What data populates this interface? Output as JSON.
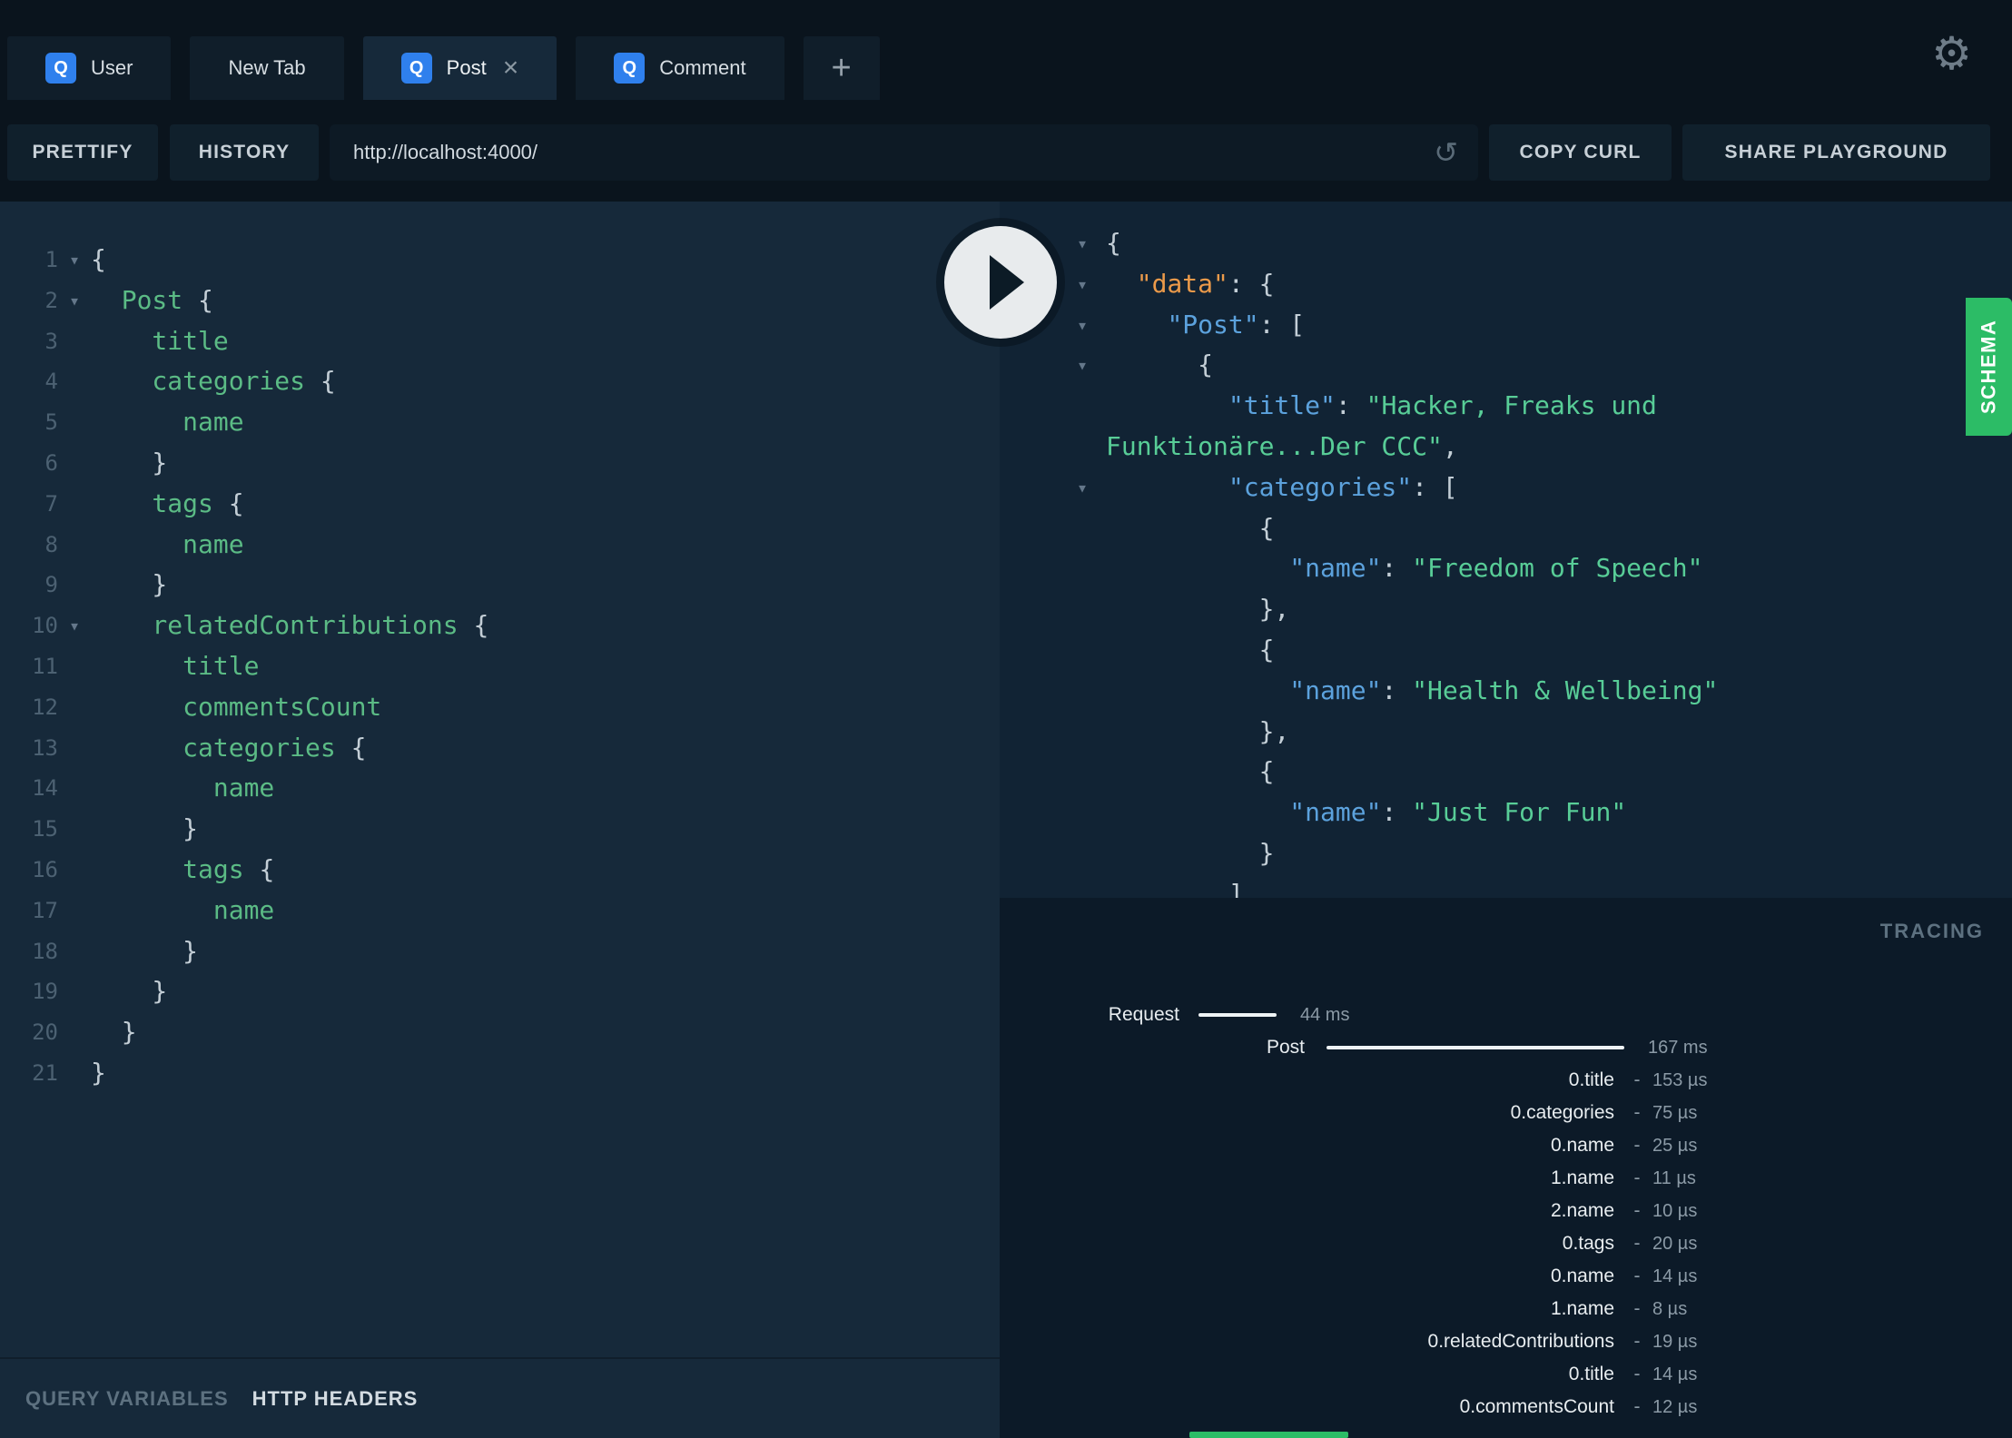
{
  "colors": {
    "bg_top": "#0a141d",
    "tab_inactive": "#101e2a",
    "editor_bg": "#16293a",
    "response_bg": "#112334",
    "tracing_bg": "#0c1a28",
    "button_bg": "#10202c",
    "url_bg": "#0d1a25",
    "accent_blue": "#2f80ed",
    "schema_green": "#2cbc66",
    "code_green": "#5bbb85",
    "str_green": "#58cd97",
    "key_blue": "#5ca2dd",
    "key_orange": "#eb9a4a",
    "punct": "#c3ced6",
    "line_number": "#4c6172",
    "text_primary": "#d7dee3",
    "text_muted": "#5d7180",
    "time_muted": "#8b9aa6"
  },
  "icons": {
    "gear": "⚙",
    "reload": "↺",
    "close": "×",
    "plus": "+",
    "fold": "▾"
  },
  "tabs": [
    {
      "label": "User",
      "badge": "Q",
      "active": false,
      "closable": false
    },
    {
      "label": "New Tab",
      "badge": "",
      "active": false,
      "closable": false
    },
    {
      "label": "Post",
      "badge": "Q",
      "active": true,
      "closable": true
    },
    {
      "label": "Comment",
      "badge": "Q",
      "active": false,
      "closable": false
    }
  ],
  "toolbar": {
    "prettify": "PRETTIFY",
    "history": "HISTORY",
    "url": "http://localhost:4000/",
    "copy_curl": "COPY CURL",
    "share_playground": "SHARE PLAYGROUND"
  },
  "query_editor": {
    "lines": [
      {
        "n": 1,
        "fold": true,
        "segs": [
          [
            "p",
            "{"
          ]
        ]
      },
      {
        "n": 2,
        "fold": true,
        "segs": [
          [
            "g",
            "  Post "
          ],
          [
            "p",
            "{"
          ]
        ]
      },
      {
        "n": 3,
        "fold": false,
        "segs": [
          [
            "g",
            "    title"
          ]
        ]
      },
      {
        "n": 4,
        "fold": false,
        "segs": [
          [
            "g",
            "    categories "
          ],
          [
            "p",
            "{"
          ]
        ]
      },
      {
        "n": 5,
        "fold": false,
        "segs": [
          [
            "g",
            "      name"
          ]
        ]
      },
      {
        "n": 6,
        "fold": false,
        "segs": [
          [
            "p",
            "    }"
          ]
        ]
      },
      {
        "n": 7,
        "fold": false,
        "segs": [
          [
            "g",
            "    tags "
          ],
          [
            "p",
            "{"
          ]
        ]
      },
      {
        "n": 8,
        "fold": false,
        "segs": [
          [
            "g",
            "      name"
          ]
        ]
      },
      {
        "n": 9,
        "fold": false,
        "segs": [
          [
            "p",
            "    }"
          ]
        ]
      },
      {
        "n": 10,
        "fold": true,
        "segs": [
          [
            "g",
            "    relatedContributions "
          ],
          [
            "p",
            "{"
          ]
        ]
      },
      {
        "n": 11,
        "fold": false,
        "segs": [
          [
            "g",
            "      title"
          ]
        ]
      },
      {
        "n": 12,
        "fold": false,
        "segs": [
          [
            "g",
            "      commentsCount"
          ]
        ]
      },
      {
        "n": 13,
        "fold": false,
        "segs": [
          [
            "g",
            "      categories "
          ],
          [
            "p",
            "{"
          ]
        ]
      },
      {
        "n": 14,
        "fold": false,
        "segs": [
          [
            "g",
            "        name"
          ]
        ]
      },
      {
        "n": 15,
        "fold": false,
        "segs": [
          [
            "p",
            "      }"
          ]
        ]
      },
      {
        "n": 16,
        "fold": false,
        "segs": [
          [
            "g",
            "      tags "
          ],
          [
            "p",
            "{"
          ]
        ]
      },
      {
        "n": 17,
        "fold": false,
        "segs": [
          [
            "g",
            "        name"
          ]
        ]
      },
      {
        "n": 18,
        "fold": false,
        "segs": [
          [
            "p",
            "      }"
          ]
        ]
      },
      {
        "n": 19,
        "fold": false,
        "segs": [
          [
            "p",
            "    }"
          ]
        ]
      },
      {
        "n": 20,
        "fold": false,
        "segs": [
          [
            "p",
            "  }"
          ]
        ]
      },
      {
        "n": 21,
        "fold": false,
        "segs": [
          [
            "p",
            "}"
          ]
        ]
      }
    ]
  },
  "response_viewer": {
    "lines": [
      {
        "fold": true,
        "segs": [
          [
            "p",
            "{"
          ]
        ]
      },
      {
        "fold": true,
        "segs": [
          [
            "p",
            "  "
          ],
          [
            "o",
            "\"data\""
          ],
          [
            "p",
            ": {"
          ]
        ]
      },
      {
        "fold": true,
        "segs": [
          [
            "p",
            "    "
          ],
          [
            "b",
            "\"Post\""
          ],
          [
            "p",
            ": ["
          ]
        ]
      },
      {
        "fold": true,
        "segs": [
          [
            "p",
            "      {"
          ]
        ]
      },
      {
        "fold": false,
        "segs": [
          [
            "p",
            "        "
          ],
          [
            "b",
            "\"title\""
          ],
          [
            "p",
            ": "
          ],
          [
            "s",
            "\"Hacker, Freaks und"
          ]
        ]
      },
      {
        "fold": false,
        "segs": [
          [
            "s",
            "Funktionäre...Der CCC\""
          ],
          [
            "p",
            ","
          ]
        ]
      },
      {
        "fold": true,
        "segs": [
          [
            "p",
            "        "
          ],
          [
            "b",
            "\"categories\""
          ],
          [
            "p",
            ": ["
          ]
        ]
      },
      {
        "fold": false,
        "segs": [
          [
            "p",
            "          {"
          ]
        ]
      },
      {
        "fold": false,
        "segs": [
          [
            "p",
            "            "
          ],
          [
            "b",
            "\"name\""
          ],
          [
            "p",
            ": "
          ],
          [
            "s",
            "\"Freedom of Speech\""
          ]
        ]
      },
      {
        "fold": false,
        "segs": [
          [
            "p",
            "          },"
          ]
        ]
      },
      {
        "fold": false,
        "segs": [
          [
            "p",
            "          {"
          ]
        ]
      },
      {
        "fold": false,
        "segs": [
          [
            "p",
            "            "
          ],
          [
            "b",
            "\"name\""
          ],
          [
            "p",
            ": "
          ],
          [
            "s",
            "\"Health & Wellbeing\""
          ]
        ]
      },
      {
        "fold": false,
        "segs": [
          [
            "p",
            "          },"
          ]
        ]
      },
      {
        "fold": false,
        "segs": [
          [
            "p",
            "          {"
          ]
        ]
      },
      {
        "fold": false,
        "segs": [
          [
            "p",
            "            "
          ],
          [
            "b",
            "\"name\""
          ],
          [
            "p",
            ": "
          ],
          [
            "s",
            "\"Just For Fun\""
          ]
        ]
      },
      {
        "fold": false,
        "segs": [
          [
            "p",
            "          }"
          ]
        ]
      },
      {
        "fold": false,
        "segs": [
          [
            "p",
            "        ]"
          ]
        ]
      }
    ]
  },
  "tracing": {
    "title": "TRACING",
    "rows": [
      {
        "type": "bar",
        "cls": "request",
        "label": "Request",
        "time": "44 ms"
      },
      {
        "type": "bar",
        "cls": "post",
        "label": "Post",
        "time": "167 ms"
      },
      {
        "type": "leaf",
        "label": "0.title",
        "time": "153 µs"
      },
      {
        "type": "leaf",
        "label": "0.categories",
        "time": "75 µs"
      },
      {
        "type": "leaf",
        "label": "0.name",
        "time": "25 µs"
      },
      {
        "type": "leaf",
        "label": "1.name",
        "time": "11 µs"
      },
      {
        "type": "leaf",
        "label": "2.name",
        "time": "10 µs"
      },
      {
        "type": "leaf",
        "label": "0.tags",
        "time": "20 µs"
      },
      {
        "type": "leaf",
        "label": "0.name",
        "time": "14 µs"
      },
      {
        "type": "leaf",
        "label": "1.name",
        "time": "8 µs"
      },
      {
        "type": "leaf",
        "label": "0.relatedContributions",
        "time": "19 µs"
      },
      {
        "type": "leaf",
        "label": "0.title",
        "time": "14 µs"
      },
      {
        "type": "leaf",
        "label": "0.commentsCount",
        "time": "12 µs"
      }
    ]
  },
  "bottom": {
    "query_variables": "QUERY VARIABLES",
    "http_headers": "HTTP HEADERS"
  },
  "schema": {
    "label": "SCHEMA"
  }
}
